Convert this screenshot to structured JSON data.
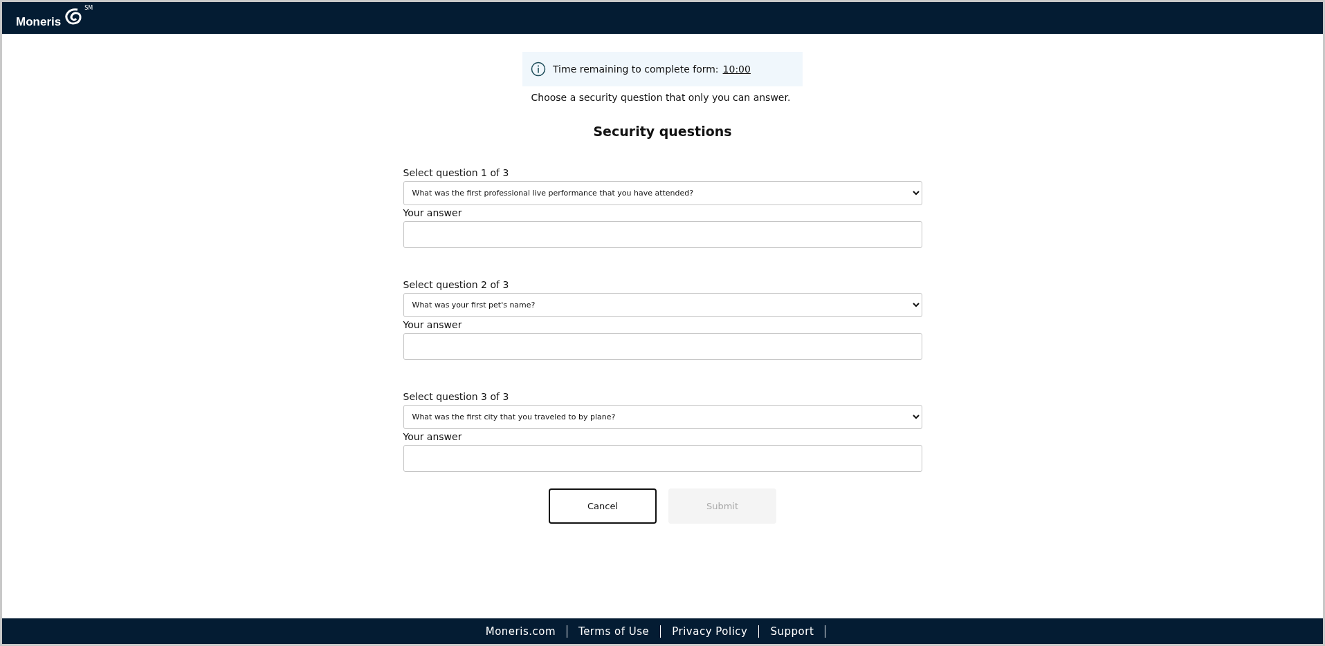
{
  "header": {
    "logo": "Moneris",
    "logo_mark": "SM"
  },
  "notice": {
    "text": "Time remaining to complete form:",
    "timer": "10:00"
  },
  "intro": "Choose a security question that only you can answer.",
  "title": "Security questions",
  "questions": [
    {
      "label": "Select question 1 of 3",
      "question": "What was the first professional live performance that you have attended?",
      "answer_label": "Your answer"
    },
    {
      "label": "Select question 2 of 3",
      "question": "What was your first pet's name?",
      "answer_label": "Your answer"
    },
    {
      "label": "Select question 3 of 3",
      "question": "What was the first city that you traveled to by plane?",
      "answer_label": "Your answer"
    }
  ],
  "buttons": [
    {
      "label": "Cancel",
      "kind": "secondary",
      "disabled": false
    },
    {
      "label": "Submit",
      "kind": "primary",
      "disabled": true
    }
  ],
  "footer": {
    "links": [
      "Moneris.com",
      "Terms of Use",
      "Privacy Policy",
      "Support"
    ]
  }
}
